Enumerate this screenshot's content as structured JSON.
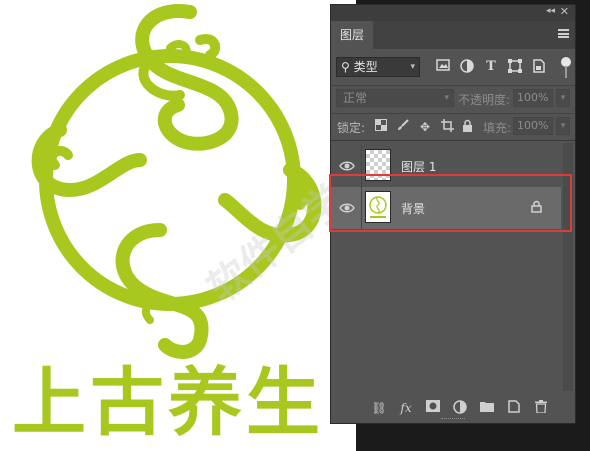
{
  "canvas": {
    "brand_text": "上古养生",
    "brand_color": "#a8c820",
    "watermark_text": "软件自学网"
  },
  "panel": {
    "tab_label": "图层",
    "collapse_icon": "double-chevron-right",
    "close_icon": "close-x",
    "menu_icon": "hamburger-menu",
    "filter": {
      "kind_label": "类型",
      "icons": [
        "image-filter-icon",
        "adjustment-filter-icon",
        "type-filter-icon",
        "shape-filter-icon",
        "smart-object-filter-icon"
      ]
    },
    "blend": {
      "mode_label": "正常",
      "opacity_label": "不透明度:",
      "opacity_value": "100%"
    },
    "lock": {
      "lock_label": "锁定:",
      "icons": [
        "lock-transparent-icon",
        "lock-paint-icon",
        "lock-move-icon",
        "lock-artboard-icon",
        "lock-all-icon"
      ],
      "fill_label": "填充:",
      "fill_value": "100%"
    },
    "layers": [
      {
        "name": "图层 1",
        "visible": true,
        "locked": false,
        "selected": false
      },
      {
        "name": "背景",
        "visible": true,
        "locked": true,
        "selected": true
      }
    ],
    "bottom_icons": [
      "link-layers-icon",
      "fx-icon",
      "add-mask-icon",
      "adjustment-layer-icon",
      "new-group-icon",
      "new-layer-icon",
      "trash-icon"
    ],
    "highlight_color": "#e03a3a"
  }
}
